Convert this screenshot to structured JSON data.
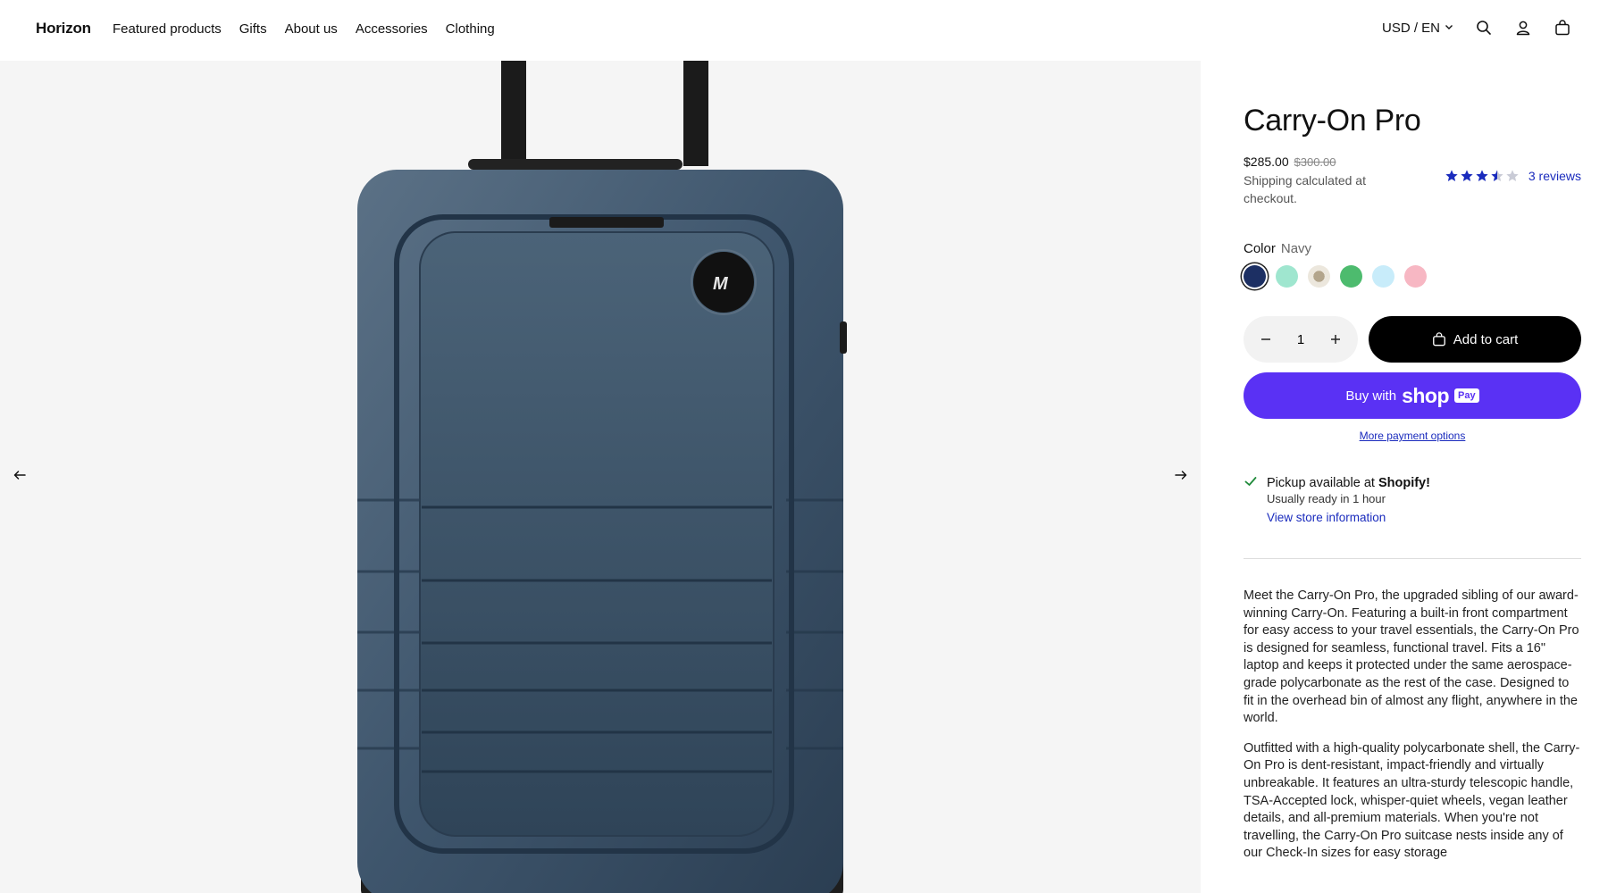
{
  "header": {
    "logo": "Horizon",
    "nav": [
      "Featured products",
      "Gifts",
      "About us",
      "Accessories",
      "Clothing"
    ],
    "locale": "USD / EN"
  },
  "product": {
    "title": "Carry-On Pro",
    "price": "$285.00",
    "compare_price": "$300.00",
    "shipping": "Shipping calculated at checkout.",
    "rating": 3.5,
    "reviews": "3 reviews",
    "color_label": "Color",
    "color_value": "Navy",
    "swatches": [
      "#1c2f63",
      "#9fe6cf",
      "#d9cbb4",
      "#4dbb6e",
      "#c8ecfa",
      "#f7b7c3"
    ],
    "selected_swatch": 0,
    "quantity": "1",
    "add_to_cart": "Add to cart",
    "shop_pay_prefix": "Buy with",
    "shop_pay_brand": "shop",
    "shop_pay_badge": "Pay",
    "more_payment": "More payment options",
    "pickup_prefix": "Pickup available at",
    "pickup_store": "Shopify!",
    "pickup_ready": "Usually ready in 1 hour",
    "store_info": "View store information",
    "description": [
      "Meet the Carry-On Pro, the upgraded sibling of our award-winning Carry-On. Featuring a built-in front compartment for easy access to your travel essentials, the Carry-On Pro is designed for seamless, functional travel. Fits a 16\" laptop and keeps it protected under the same aerospace-grade polycarbonate as the rest of the case. Designed to fit in the overhead bin of almost any flight, anywhere in the world.",
      "Outfitted with a high-quality polycarbonate shell, the Carry-On Pro is dent-resistant, impact-friendly and virtually unbreakable. It features an ultra-sturdy telescopic handle, TSA-Accepted lock, whisper-quiet wheels, vegan leather details, and all-premium materials. When you're not travelling, the Carry-On Pro suitcase nests inside any of our Check-In sizes for easy storage"
    ]
  },
  "colors": {
    "accent_link": "#1a2bbd",
    "shop_pay": "#5a31f4",
    "star": "#1a2bbd",
    "gallery_bg": "#f5f5f5"
  }
}
